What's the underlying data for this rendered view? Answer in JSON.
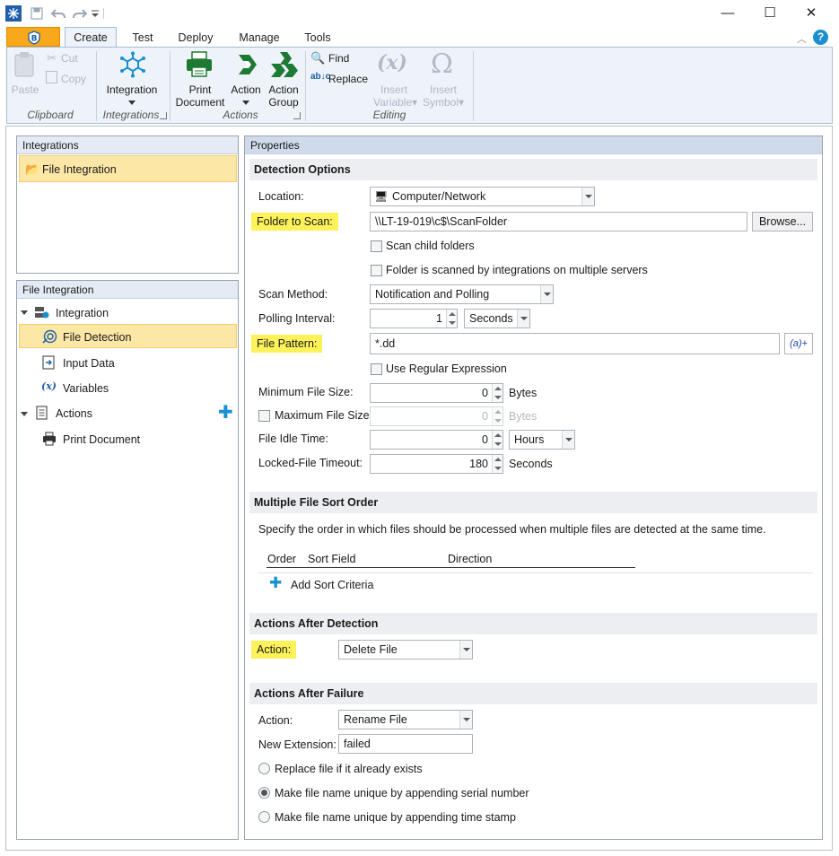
{
  "quick_access": {
    "icons": [
      "app-icon",
      "save-icon",
      "undo-icon",
      "redo-icon",
      "customize-icon"
    ]
  },
  "window_controls": {
    "minimize": "—",
    "maximize": "☐",
    "close": "✕"
  },
  "tabs": [
    {
      "label": "Create",
      "active": true
    },
    {
      "label": "Test"
    },
    {
      "label": "Deploy"
    },
    {
      "label": "Manage"
    },
    {
      "label": "Tools"
    }
  ],
  "ribbon": {
    "clipboard": {
      "paste": "Paste",
      "cut": "Cut",
      "copy": "Copy",
      "group": "Clipboard"
    },
    "integrations": {
      "integration": "Integration",
      "group": "Integrations"
    },
    "actions": {
      "print_document_1": "Print",
      "print_document_2": "Document",
      "action": "Action",
      "action_group_1": "Action",
      "action_group_2": "Group",
      "group": "Actions"
    },
    "editing": {
      "find": "Find",
      "replace": "Replace",
      "insert_variable_1": "Insert",
      "insert_variable_2": "Variable",
      "insert_symbol_1": "Insert",
      "insert_symbol_2": "Symbol",
      "group": "Editing"
    }
  },
  "integrations_panel": {
    "title": "Integrations",
    "items": [
      {
        "label": "File Integration",
        "selected": true
      }
    ]
  },
  "tree_panel": {
    "title": "File Integration",
    "integration": "Integration",
    "file_detection": "File Detection",
    "input_data": "Input Data",
    "variables": "Variables",
    "actions": "Actions",
    "print_document": "Print Document"
  },
  "properties": {
    "title": "Properties",
    "detection": {
      "header": "Detection Options",
      "location_label": "Location:",
      "location_value": "Computer/Network",
      "folder_label": "Folder to Scan:",
      "folder_value": "\\\\LT-19-019\\c$\\ScanFolder",
      "browse": "Browse...",
      "scan_child": "Scan child folders",
      "multi_server": "Folder is scanned by integrations on multiple servers",
      "scan_method_label": "Scan Method:",
      "scan_method_value": "Notification and Polling",
      "polling_label": "Polling Interval:",
      "polling_value": "1",
      "polling_unit": "Seconds",
      "pattern_label": "File Pattern:",
      "pattern_value": "*.dd",
      "pattern_insert": "(a)+",
      "use_regex": "Use Regular Expression",
      "min_size_label": "Minimum File Size:",
      "min_size_value": "0",
      "min_size_unit": "Bytes",
      "max_size_label": "Maximum File Size:",
      "max_size_value": "0",
      "max_size_unit": "Bytes",
      "idle_label": "File Idle Time:",
      "idle_value": "0",
      "idle_unit": "Hours",
      "locked_label": "Locked-File Timeout:",
      "locked_value": "180",
      "locked_unit": "Seconds"
    },
    "sort": {
      "header": "Multiple File Sort Order",
      "description": "Specify the order in which files should be processed when multiple files are detected at the same time.",
      "col_order": "Order",
      "col_field": "Sort Field",
      "col_direction": "Direction",
      "add": "Add Sort Criteria"
    },
    "after_detection": {
      "header": "Actions After Detection",
      "action_label": "Action:",
      "action_value": "Delete File"
    },
    "after_failure": {
      "header": "Actions After Failure",
      "action_label": "Action:",
      "action_value": "Rename File",
      "ext_label": "New Extension:",
      "ext_value": "failed",
      "opt_replace": "Replace file if it already exists",
      "opt_serial": "Make file name unique by appending serial number",
      "opt_timestamp": "Make file name unique by appending time stamp",
      "selected_option": "serial"
    }
  },
  "colors": {
    "accent_orange": "#f7a81b",
    "highlight_yellow": "#fdf25a",
    "selection": "#fde7a6",
    "icon_green": "#1e7a32",
    "icon_blue": "#1a8fd0"
  }
}
